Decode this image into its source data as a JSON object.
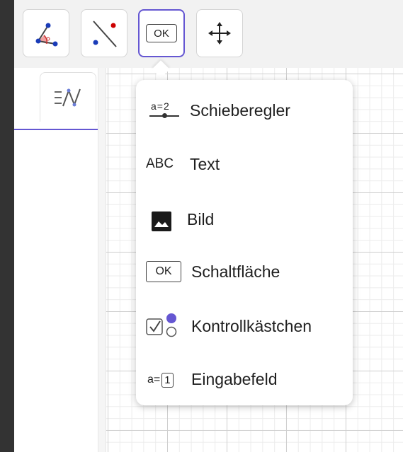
{
  "menu": {
    "items": [
      {
        "label": "Schieberegler",
        "icon": "slider-icon",
        "icon_text": "a=2"
      },
      {
        "label": "Text",
        "icon": "text-icon",
        "icon_text": "ABC"
      },
      {
        "label": "Bild",
        "icon": "image-icon"
      },
      {
        "label": "Schaltfläche",
        "icon": "button-tool-icon",
        "icon_text": "OK"
      },
      {
        "label": "Kontrollkästchen",
        "icon": "checkbox-icon"
      },
      {
        "label": "Eingabefeld",
        "icon": "input-box-icon",
        "icon_text": "a=",
        "icon_box": "1"
      }
    ]
  },
  "toolbar": {
    "tools": [
      {
        "name": "angle-tool",
        "active": false
      },
      {
        "name": "segment-tool",
        "active": false
      },
      {
        "name": "button-tool",
        "active": true,
        "icon_text": "OK"
      },
      {
        "name": "move-graphics-tool",
        "active": false
      }
    ]
  },
  "colors": {
    "accent": "#6557d2",
    "point_blue": "#1a3cb8",
    "point_red": "#cc0000",
    "angle_fill": "#f0a0a0",
    "background_dark": "#333333"
  }
}
